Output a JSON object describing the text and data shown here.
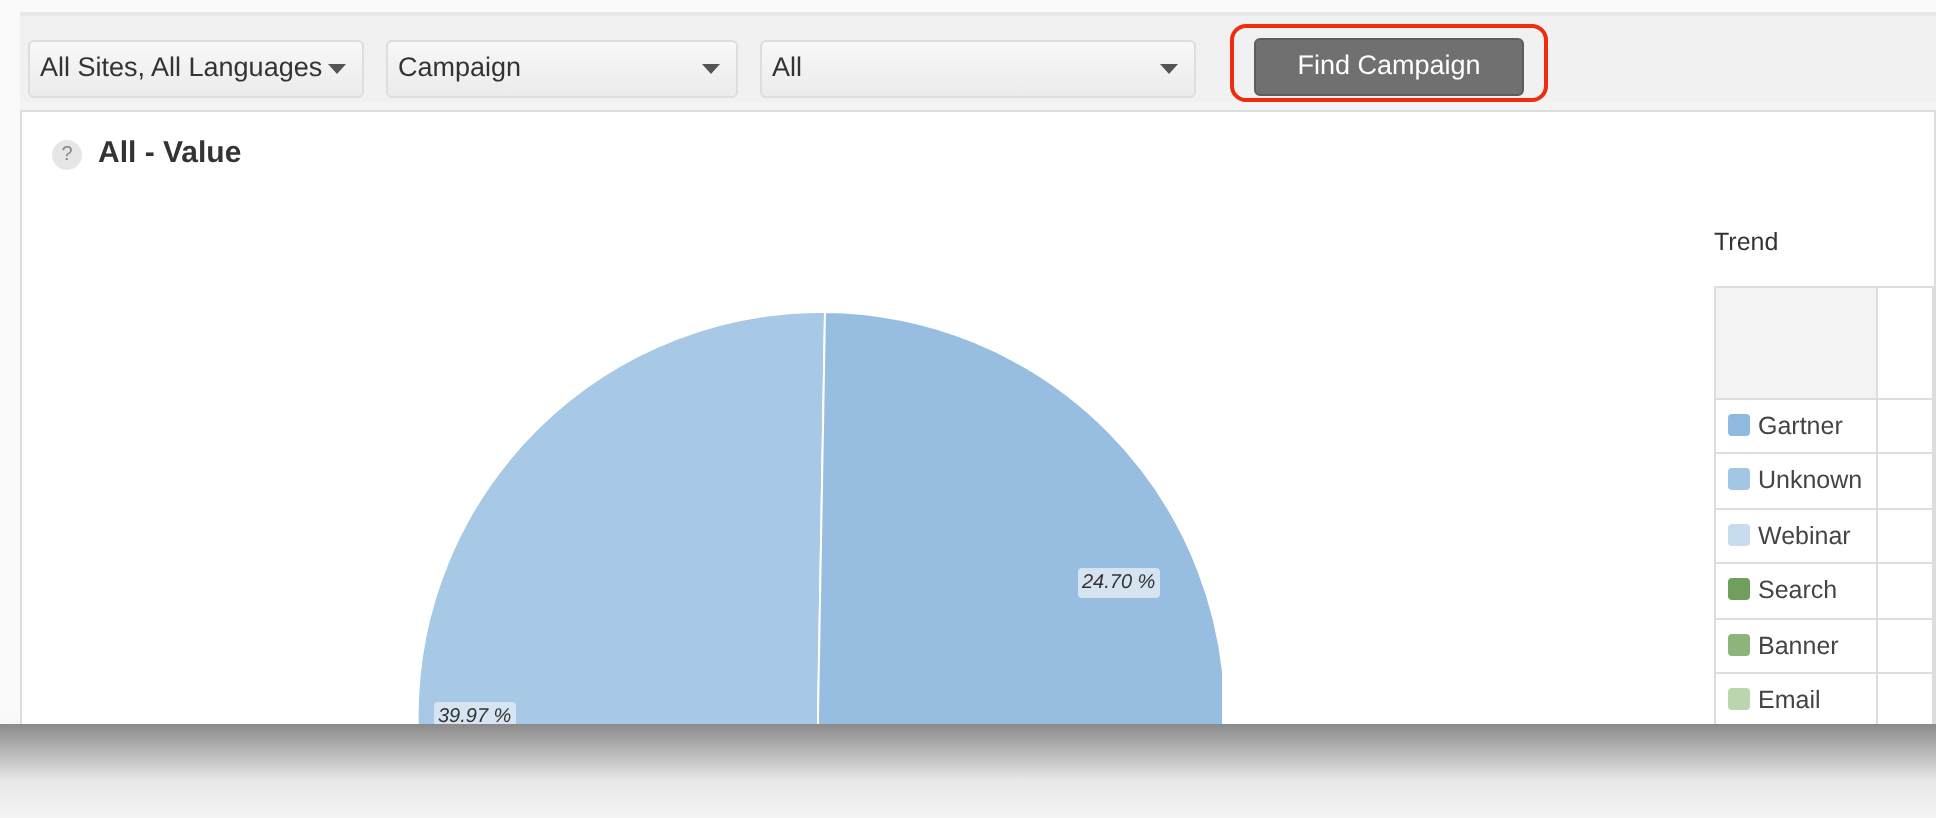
{
  "toolbar": {
    "selects": [
      {
        "value": "All Sites, All Languages"
      },
      {
        "value": "Campaign"
      },
      {
        "value": "All"
      }
    ],
    "button": {
      "label": "Find Campaign",
      "highlighted": true
    }
  },
  "panel": {
    "help": "?",
    "title": "All - Value",
    "pie": {
      "slices": [
        {
          "color": "#a7c9e5",
          "label": "39.97 %"
        },
        {
          "color": "#97bee0",
          "label": "24.70 %"
        }
      ]
    },
    "trend": {
      "title": "Trend",
      "rows": [
        {
          "name": "Gartner",
          "color": "#8fb9df"
        },
        {
          "name": "Unknown",
          "color": "#a4c6e5"
        },
        {
          "name": "Webinar",
          "color": "#c8dcef"
        },
        {
          "name": "Search",
          "color": "#6f9e5d"
        },
        {
          "name": "Banner",
          "color": "#8db57b"
        },
        {
          "name": "Email",
          "color": "#bbd5af"
        }
      ]
    }
  }
}
